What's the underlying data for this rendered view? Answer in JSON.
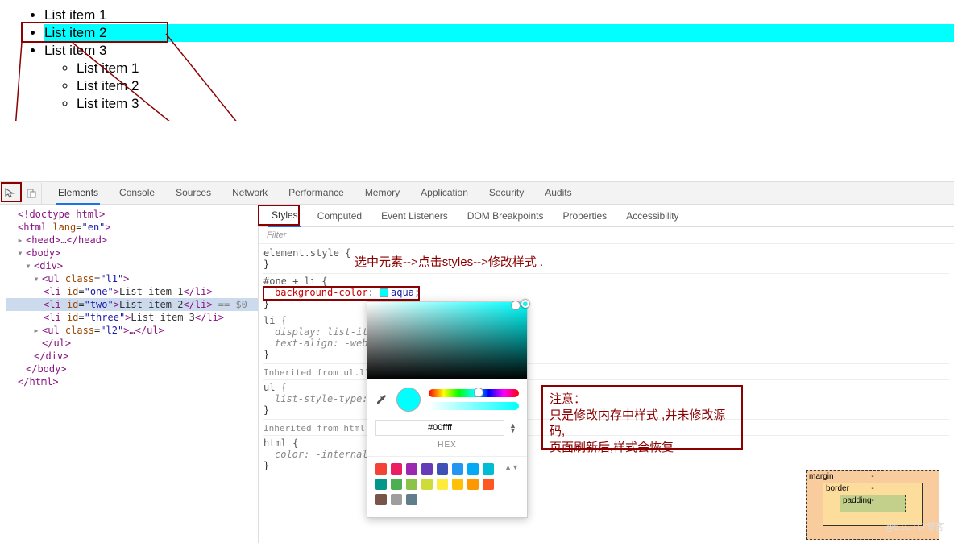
{
  "page": {
    "list": [
      "List item 1",
      "List item 2",
      "List item 3"
    ],
    "sublist": [
      "List item 1",
      "List item 2",
      "List item 3"
    ]
  },
  "devtools": {
    "tabs": [
      "Elements",
      "Console",
      "Sources",
      "Network",
      "Performance",
      "Memory",
      "Application",
      "Security",
      "Audits"
    ],
    "active_tab": "Elements",
    "subtabs": [
      "Styles",
      "Computed",
      "Event Listeners",
      "DOM Breakpoints",
      "Properties",
      "Accessibility"
    ],
    "active_subtab": "Styles",
    "filter_placeholder": "Filter",
    "dom": {
      "l0": "<!doctype html>",
      "l1a": "<html ",
      "l1b": "lang",
      "l1c": "\"en\"",
      "l1d": ">",
      "l2": "<head>…</head>",
      "l3": "<body>",
      "l4": "<div>",
      "l5a": "<ul ",
      "l5b": "class",
      "l5c": "\"l1\"",
      "l5d": ">",
      "l6a": "<li ",
      "l6b": "id",
      "l6c": "\"one\"",
      "l6d": ">",
      "l6e": "List item 1",
      "l6f": "</li>",
      "l7a": "<li ",
      "l7b": "id",
      "l7c": "\"two\"",
      "l7d": ">",
      "l7e": "List item 2",
      "l7f": "</li>",
      "l7g": " == $0",
      "l8a": "<li ",
      "l8b": "id",
      "l8c": "\"three\"",
      "l8d": ">",
      "l8e": "List item 3",
      "l8f": "</li>",
      "l9a": "<ul ",
      "l9b": "class",
      "l9c": "\"l2\"",
      "l9d": ">…</ul>",
      "l10": "</ul>",
      "l11": "</div>",
      "l12": "</body>",
      "l13": "</html>"
    },
    "styles": {
      "r1_sel": "element.style {",
      "r1_close": "}",
      "r2_sel": "#one + li {",
      "r2_prop": "background-color",
      "r2_val": "aqua",
      "r2_close": "}",
      "r3_sel": "li {",
      "r3_p1n": "display",
      "r3_p1v": "list-ite",
      "r3_p2n": "text-align",
      "r3_p2v": "-webk",
      "r3_close": "}",
      "inh1": "Inherited from ",
      "inh1_el": "ul.l1",
      "r4_sel": "ul {",
      "r4_p1n": "list-style-type",
      "r4_p1v": "",
      "r4_close": "}",
      "inh2": "Inherited from ",
      "inh2_el": "html",
      "r5_sel": "html {",
      "r5_p1n": "color",
      "r5_p1v": "-internal-",
      "r5_close": "}"
    }
  },
  "annotations": {
    "a1": "选中元素-->点击styles-->修改样式 .",
    "a2_l1": "注意：",
    "a2_l2": "只是修改内存中样式 ,并未修改源码,",
    "a2_l3": "页面刷新后,样式会恢复"
  },
  "picker": {
    "hex": "#00ffff",
    "hex_label": "HEX",
    "row1": [
      "#f44336",
      "#e91e63",
      "#9c27b0",
      "#673ab7",
      "#3f51b5",
      "#2196f3",
      "#03a9f4",
      "#00bcd4"
    ],
    "row2": [
      "#009688",
      "#4caf50",
      "#8bc34a",
      "#cddc39",
      "#ffeb3b",
      "#ffc107",
      "#ff9800",
      "#ff5722"
    ],
    "row3": [
      "#795548",
      "#9e9e9e",
      "#607d8b"
    ]
  },
  "boxmodel": {
    "margin": "margin",
    "border": "border",
    "padding": "padding",
    "dash": "-"
  },
  "watermark": "@51CTO博客"
}
